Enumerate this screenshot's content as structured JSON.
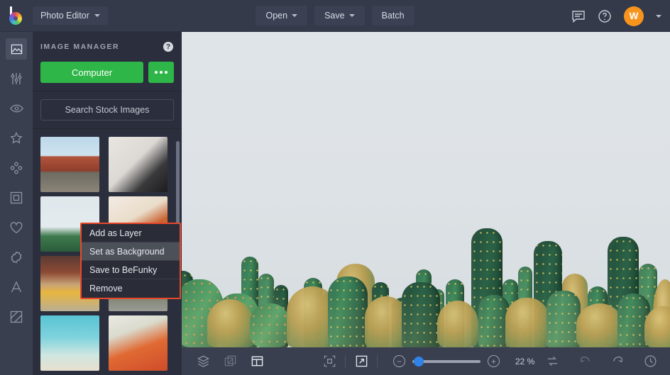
{
  "topbar": {
    "logo_name": "befunky-logo",
    "app_switcher_label": "Photo Editor",
    "open_label": "Open",
    "save_label": "Save",
    "batch_label": "Batch",
    "feedback_icon": "chat-icon",
    "help_icon": "question-circle-icon",
    "avatar_initial": "W"
  },
  "rail": {
    "items": [
      {
        "name": "image",
        "icon": "image-icon",
        "active": true
      },
      {
        "name": "edit",
        "icon": "sliders-icon",
        "active": false
      },
      {
        "name": "touch-up",
        "icon": "eye-icon",
        "active": false
      },
      {
        "name": "effects",
        "icon": "star-icon",
        "active": false
      },
      {
        "name": "artsy",
        "icon": "dots-cluster-icon",
        "active": false
      },
      {
        "name": "frames",
        "icon": "frame-square-icon",
        "active": false
      },
      {
        "name": "overlays",
        "icon": "heart-icon",
        "active": false
      },
      {
        "name": "textures",
        "icon": "badge-icon",
        "active": false
      },
      {
        "name": "text",
        "icon": "letter-a-icon",
        "active": false
      },
      {
        "name": "graphics",
        "icon": "diagonal-square-icon",
        "active": false
      }
    ]
  },
  "panel": {
    "title": "IMAGE MANAGER",
    "help_icon": "question-mark-icon",
    "computer_label": "Computer",
    "more_icon": "ellipsis-icon",
    "search_stock_label": "Search Stock Images",
    "thumbnails": [
      {
        "name": "thumb-dubrovnik",
        "art": "t-dubrovnik"
      },
      {
        "name": "thumb-desk-flatlay",
        "art": "t-desk"
      },
      {
        "name": "thumb-cactus",
        "art": "t-cactus"
      },
      {
        "name": "thumb-food-bowl",
        "art": "t-food1"
      },
      {
        "name": "thumb-desert-road",
        "art": "t-road"
      },
      {
        "name": "thumb-scooter-road",
        "art": "t-scooter"
      },
      {
        "name": "thumb-ocean",
        "art": "t-ocean"
      },
      {
        "name": "thumb-pizza",
        "art": "t-pizza"
      }
    ]
  },
  "context_menu": {
    "border_color": "#e8482a",
    "items": [
      {
        "label": "Add as Layer",
        "highlighted": false
      },
      {
        "label": "Set as Background",
        "highlighted": true
      },
      {
        "label": "Save to BeFunky",
        "highlighted": false
      },
      {
        "label": "Remove",
        "highlighted": false
      }
    ]
  },
  "canvas": {
    "image_description": "Row of green cacti against a pale grey-blue sky"
  },
  "bottombar": {
    "layers_icon": "layers-icon",
    "transform_icon": "duplicate-layer-icon",
    "image_manager_icon": "panel-grid-icon",
    "fit_icon": "fit-to-screen-icon",
    "expand_icon": "fullscreen-expand-icon",
    "zoom_out_label": "−",
    "zoom_in_label": "+",
    "zoom_value": "22 %",
    "compare_icon": "compare-swap-icon",
    "undo_icon": "undo-icon",
    "redo_icon": "redo-icon",
    "history_icon": "history-clock-icon"
  }
}
